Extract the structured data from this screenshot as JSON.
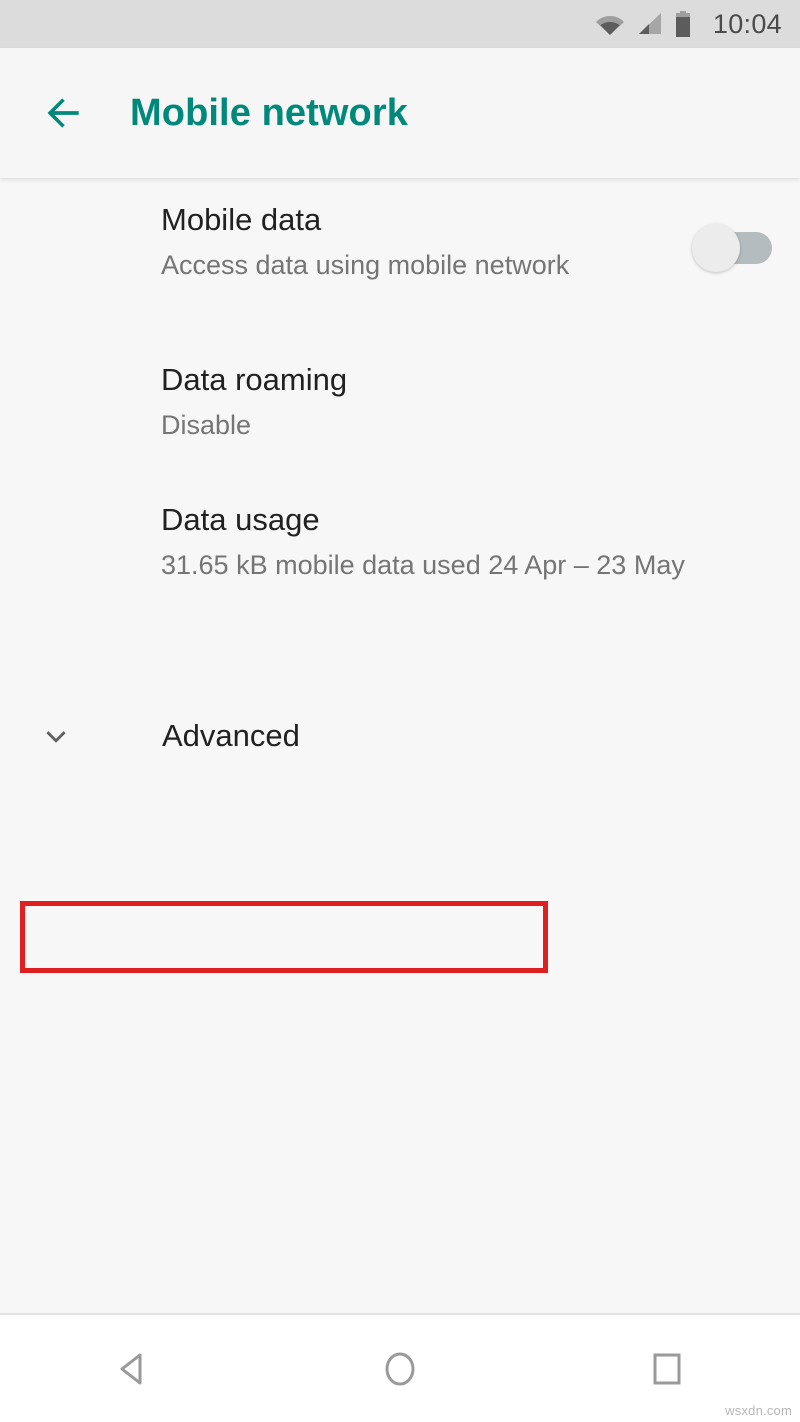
{
  "status_bar": {
    "time": "10:04",
    "icons": [
      "wifi-icon",
      "cellular-signal-icon",
      "battery-icon"
    ],
    "background_color": "#dcdcdc"
  },
  "app_bar": {
    "back_icon": "arrow-left-icon",
    "title": "Mobile network",
    "accent_color": "#00897b"
  },
  "settings": {
    "mobile_data": {
      "title": "Mobile data",
      "subtitle": "Access data using mobile network",
      "toggle_state": "off"
    },
    "data_roaming": {
      "title": "Data roaming",
      "subtitle": "Disable"
    },
    "data_usage": {
      "title": "Data usage",
      "subtitle": "31.65 kB mobile data used 24 Apr – 23 May"
    },
    "advanced": {
      "label": "Advanced",
      "icon": "chevron-down-icon",
      "expanded": "false",
      "highlight_color": "#e02020"
    }
  },
  "nav_bar": {
    "back": "back-triangle-icon",
    "home": "home-circle-icon",
    "recents": "recents-square-icon"
  },
  "watermark": "wsxdn.com"
}
